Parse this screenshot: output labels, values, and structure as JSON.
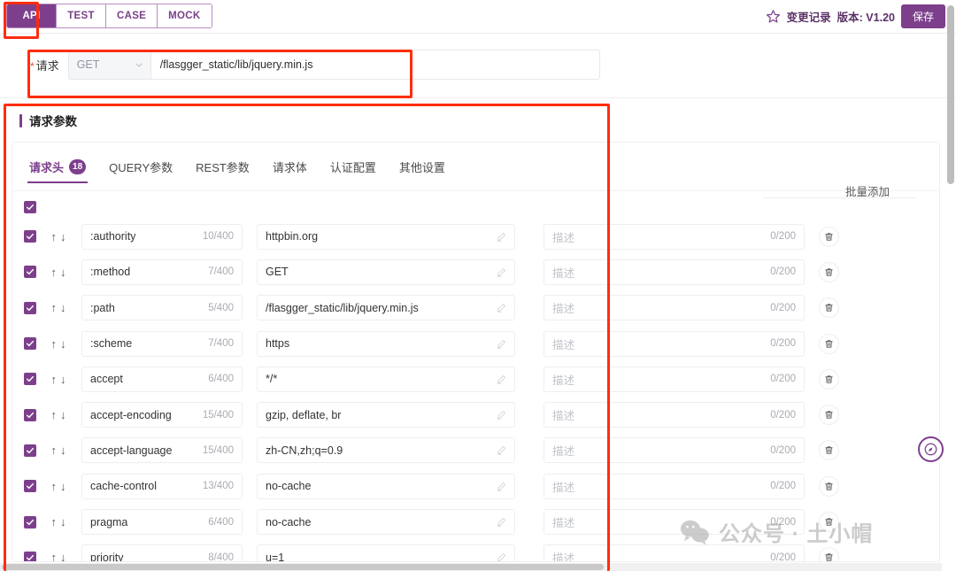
{
  "header": {
    "tabs": [
      {
        "label": "API",
        "active": true
      },
      {
        "label": "TEST",
        "active": false
      },
      {
        "label": "CASE",
        "active": false
      },
      {
        "label": "MOCK",
        "active": false
      }
    ],
    "star_icon": "star-icon",
    "changelog_label": "变更记录",
    "version_label": "版本: V1.20",
    "save_label": "保存",
    "accent_color": "#7d3f8c"
  },
  "request": {
    "required_mark": "*",
    "label": "请求",
    "method": "GET",
    "method_icon": "chevron-down-icon",
    "url": "/flasgger_static/lib/jquery.min.js"
  },
  "params": {
    "section_title": "请求参数",
    "tabs": [
      {
        "label": "请求头",
        "badge": "18",
        "active": true
      },
      {
        "label": "QUERY参数",
        "badge": "",
        "active": false
      },
      {
        "label": "REST参数",
        "badge": "",
        "active": false
      },
      {
        "label": "请求体",
        "badge": "",
        "active": false
      },
      {
        "label": "认证配置",
        "badge": "",
        "active": false
      },
      {
        "label": "其他设置",
        "badge": "",
        "active": false
      }
    ],
    "bulk_add_label": "批量添加",
    "desc_placeholder": "描述",
    "desc_counter": "0/200",
    "value_edit_icon": "pen-icon",
    "delete_icon": "trash-icon",
    "sort_up_icon": "arrow-up-icon",
    "sort_down_icon": "arrow-down-icon",
    "select_all_checked": true,
    "rows": [
      {
        "checked": true,
        "key": ":authority",
        "key_counter": "10/400",
        "value": "httpbin.org"
      },
      {
        "checked": true,
        "key": ":method",
        "key_counter": "7/400",
        "value": "GET"
      },
      {
        "checked": true,
        "key": ":path",
        "key_counter": "5/400",
        "value": "/flasgger_static/lib/jquery.min.js"
      },
      {
        "checked": true,
        "key": ":scheme",
        "key_counter": "7/400",
        "value": "https"
      },
      {
        "checked": true,
        "key": "accept",
        "key_counter": "6/400",
        "value": "*/*"
      },
      {
        "checked": true,
        "key": "accept-encoding",
        "key_counter": "15/400",
        "value": "gzip, deflate, br"
      },
      {
        "checked": true,
        "key": "accept-language",
        "key_counter": "15/400",
        "value": "zh-CN,zh;q=0.9"
      },
      {
        "checked": true,
        "key": "cache-control",
        "key_counter": "13/400",
        "value": "no-cache"
      },
      {
        "checked": true,
        "key": "pragma",
        "key_counter": "6/400",
        "value": "no-cache"
      },
      {
        "checked": true,
        "key": "priority",
        "key_counter": "8/400",
        "value": "u=1"
      }
    ]
  },
  "watermark": {
    "text": "公众号 · 土小帽",
    "icon": "wechat-icon"
  },
  "fab": {
    "icon": "compass-icon"
  },
  "annotations": {
    "api_tab": "highlight-api-tab",
    "request_row": "highlight-request-row",
    "params_panel": "highlight-params-panel"
  }
}
